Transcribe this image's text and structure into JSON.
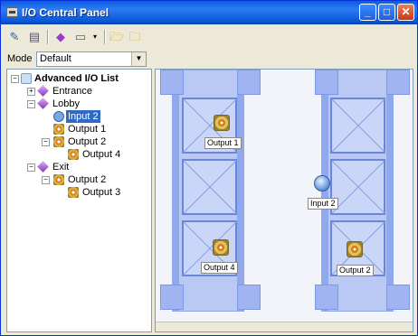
{
  "window": {
    "title": "I/O Central Panel"
  },
  "toolbar": {
    "icons": [
      "wand-icon",
      "panel-icon",
      "diamond-icon",
      "window-icon",
      "dropdown-arrow-icon",
      "folder-open-icon",
      "folder-icon"
    ]
  },
  "mode": {
    "label": "Mode",
    "value": "Default"
  },
  "tree": {
    "root": "Advanced I/O List",
    "nodes": {
      "entrance": "Entrance",
      "lobby": "Lobby",
      "lobby_input2": "Input 2",
      "lobby_output1": "Output 1",
      "lobby_output2": "Output 2",
      "lobby_output4": "Output 4",
      "exit": "Exit",
      "exit_output2": "Output 2",
      "exit_output3": "Output 3"
    }
  },
  "map": {
    "markers": {
      "output1": "Output 1",
      "output4": "Output 4",
      "input2": "Input 2",
      "output2": "Output 2"
    }
  }
}
